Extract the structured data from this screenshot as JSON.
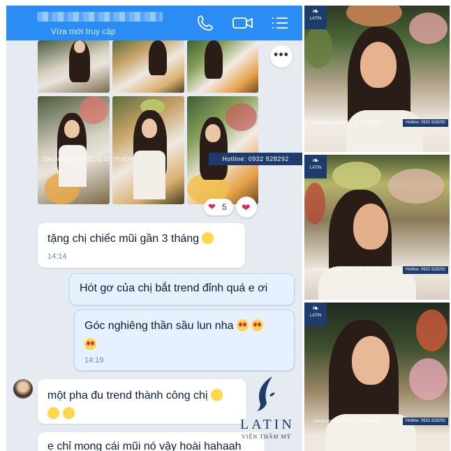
{
  "header": {
    "subtitle": "Vừa mới truy cập",
    "icons": [
      "phone-icon",
      "video-icon",
      "list-icon"
    ]
  },
  "photo_watermark": {
    "address": "204 Đường 3/2, P.12, Q.10, TP.HCM",
    "hotline": "Hotline: 0932 828292"
  },
  "reactions": {
    "heart_count": "5",
    "heart_glyph": "❤",
    "more_glyph": "•••"
  },
  "messages": [
    {
      "text": "tặng chị chiếc mũi gần 3 tháng",
      "emoji": "laughing",
      "time": "14:14",
      "side": "in"
    },
    {
      "text": "Hót gơ của chị bắt trend đỉnh quá e ơi",
      "side": "out"
    },
    {
      "text": "Góc nghiêng thần sầu lun nha",
      "emoji": "heart-eyes",
      "time": "14:19",
      "side": "out"
    },
    {
      "text": "một pha đu trend thành công chị",
      "emoji": "rofl",
      "side": "in"
    },
    {
      "text": "e chỉ mong cái mũi nó vậy hoài hahaah",
      "side": "in"
    }
  ],
  "brand": {
    "name": "LATIN",
    "tagline": "VIỆN THẨM MỸ",
    "logo_small": "LATIN",
    "color": "#1d3b6b"
  },
  "colors": {
    "header": "#2a8cf4",
    "chat_bg": "#e6ebf2",
    "outgoing_bubble": "#e5f1ff",
    "text": "#081c36"
  }
}
